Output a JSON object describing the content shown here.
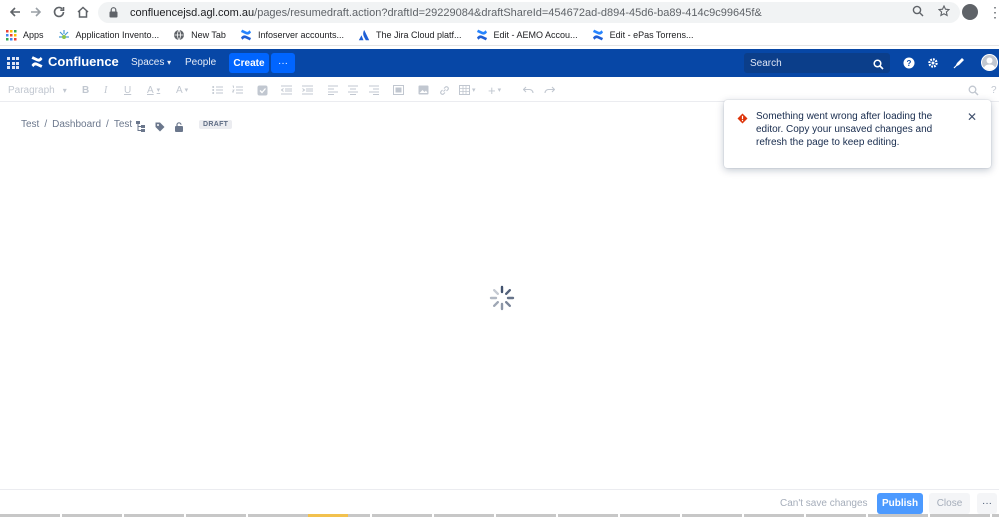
{
  "browser": {
    "url_host": "confluencejsd.agl.com.au",
    "url_path": "/pages/resumedraft.action?draftId=29229084&draftShareId=454672ad-d894-45d6-ba89-414c9c99645f&"
  },
  "bookmarks": [
    {
      "label": "Apps",
      "icon": "apps-grid-icon"
    },
    {
      "label": "Application Invento...",
      "icon": "app-inventor-icon"
    },
    {
      "label": "New Tab",
      "icon": "globe-icon"
    },
    {
      "label": "Infoserver accounts...",
      "icon": "confluence-icon"
    },
    {
      "label": "The Jira Cloud platf...",
      "icon": "atlassian-icon"
    },
    {
      "label": "Edit - AEMO Accou...",
      "icon": "confluence-icon"
    },
    {
      "label": "Edit - ePas Torrens...",
      "icon": "confluence-icon"
    }
  ],
  "header": {
    "logo_text": "Confluence",
    "spaces_label": "Spaces",
    "people_label": "People",
    "create_label": "Create",
    "more_label": "···",
    "search_placeholder": "Search",
    "brand_color": "#0747a6",
    "create_color": "#0065ff"
  },
  "toolbar": {
    "paragraph_label": "Paragraph"
  },
  "breadcrumb": {
    "items": [
      "Test",
      "Dashboard",
      "Test"
    ],
    "draft_badge": "DRAFT"
  },
  "error": {
    "message": "Something went wrong after loading the editor. Copy your unsaved changes and refresh the page to keep editing.",
    "icon_color": "#de350b"
  },
  "footer": {
    "status": "Can't save changes",
    "publish_label": "Publish",
    "close_label": "Close",
    "more_label": "···"
  }
}
